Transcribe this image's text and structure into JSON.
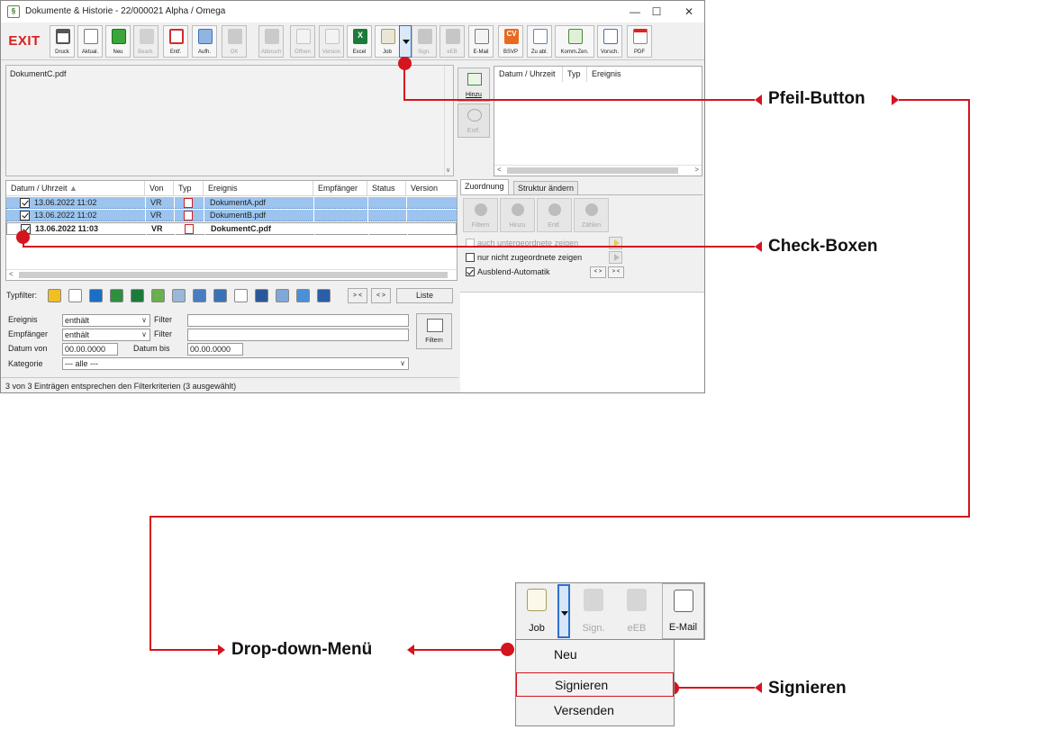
{
  "window": {
    "title": "Dokumente & Historie - 22/000021  Alpha / Omega",
    "controls": {
      "minimize": "—",
      "maximize": "☐",
      "close": "✕"
    }
  },
  "toolbar": {
    "exit": "EXIT",
    "buttons": [
      {
        "id": "druck",
        "label": "Druck",
        "icon": "printer-icon",
        "enabled": true
      },
      {
        "id": "aktual",
        "label": "Aktual.",
        "icon": "refresh-doc-icon",
        "enabled": true
      },
      {
        "id": "neu",
        "label": "Neu",
        "icon": "plus-icon",
        "enabled": true
      },
      {
        "id": "bearb",
        "label": "Bearb.",
        "icon": "edit-icon",
        "enabled": false
      },
      {
        "id": "entf",
        "label": "Entf.",
        "icon": "delete-icon",
        "enabled": true
      },
      {
        "id": "aufh",
        "label": "Aufh.",
        "icon": "structure-icon",
        "enabled": true
      },
      {
        "id": "ok",
        "label": "OK",
        "icon": "check-icon",
        "enabled": false
      },
      {
        "id": "abbrechen",
        "label": "Abbruch",
        "icon": "cancel-icon",
        "enabled": false
      },
      {
        "id": "offnen",
        "label": "Öffnen",
        "icon": "open-icon",
        "enabled": false
      },
      {
        "id": "version",
        "label": "Version",
        "icon": "version-icon",
        "enabled": false
      },
      {
        "id": "excel",
        "label": "Excel",
        "icon": "excel-icon",
        "enabled": true
      },
      {
        "id": "job",
        "label": "Job",
        "icon": "job-icon",
        "enabled": true
      },
      {
        "id": "sign",
        "label": "Sign.",
        "icon": "sign-icon",
        "enabled": false
      },
      {
        "id": "eeb",
        "label": "eEB",
        "icon": "eeb-icon",
        "enabled": false
      },
      {
        "id": "email",
        "label": "E-Mail",
        "icon": "mail-icon",
        "enabled": true
      },
      {
        "id": "bsvp",
        "label": "BSVP",
        "icon": "cv-icon",
        "enabled": true
      },
      {
        "id": "zuabl",
        "label": "Zu abl.",
        "icon": "clipboard-icon",
        "enabled": true
      },
      {
        "id": "kommzen",
        "label": "Komm.Zen.",
        "icon": "komm-icon",
        "enabled": true
      },
      {
        "id": "vorsch",
        "label": "Vorsch.",
        "icon": "preview-icon",
        "enabled": true
      },
      {
        "id": "pdf",
        "label": "PDF",
        "icon": "pdf-icon",
        "enabled": true
      }
    ]
  },
  "docpanel": {
    "entry": "DokumentC.pdf"
  },
  "side": {
    "hinzu": "Hinzu",
    "entf": "Entf."
  },
  "assign": {
    "columns": [
      "Datum / Uhrzeit",
      "Typ",
      "Ereignis"
    ]
  },
  "events": {
    "columns": [
      "Datum / Uhrzeit",
      "Von",
      "Typ",
      "Ereignis",
      "Empfänger",
      "Status",
      "Version"
    ],
    "rows": [
      {
        "date": "13.06.2022  11:02",
        "von": "VR",
        "ereignis": "DokumentA.pdf",
        "selected": false
      },
      {
        "date": "13.06.2022  11:02",
        "von": "VR",
        "ereignis": "DokumentB.pdf",
        "selected": false
      },
      {
        "date": "13.06.2022  11:03",
        "von": "VR",
        "ereignis": "DokumentC.pdf",
        "selected": true
      }
    ]
  },
  "tabs": {
    "zuordnung": "Zuordnung",
    "struktur": "Struktur ändern"
  },
  "struct": {
    "buttons": [
      "Filtern",
      "Hinzu",
      "Entf.",
      "Zählen"
    ],
    "opt1": "auch untergeordnete zeigen",
    "opt2": "nur nicht zugeordnete zeigen",
    "opt3": "Ausblend-Automatik",
    "nav1": "< >",
    "nav2": "> <"
  },
  "filterbar": {
    "label": "Typfilter:",
    "collapse": "> <",
    "expand": "< >",
    "liste": "Liste"
  },
  "criteria": {
    "ereignis": "Ereignis",
    "ereignis_value": "enthält",
    "filter": "Filter",
    "empfaenger": "Empfänger",
    "empfaenger_value": "enthält",
    "datum_von": "Datum von",
    "datum_von_value": "00.00.0000",
    "datum_bis": "Datum bis",
    "datum_bis_value": "00.00.0000",
    "kategorie": "Kategorie",
    "kategorie_value": "--- alle ---",
    "filtern": "Filtern"
  },
  "status": "3 von 3 Einträgen entsprechen den Filterkriterien (3 ausgewählt)",
  "callouts": {
    "pfeil": "Pfeil-Button",
    "check": "Check-Boxen",
    "dropdown": "Drop-down-Menü",
    "signieren": "Signieren"
  },
  "zoom": {
    "job": "Job",
    "sign": "Sign.",
    "eeb": "eEB",
    "email": "E-Mail",
    "menu": [
      "Neu",
      "Signieren",
      "Versenden"
    ]
  },
  "colors": {
    "accent": "#d4141e",
    "selection": "#9cc4ee",
    "exit": "#d42020"
  }
}
